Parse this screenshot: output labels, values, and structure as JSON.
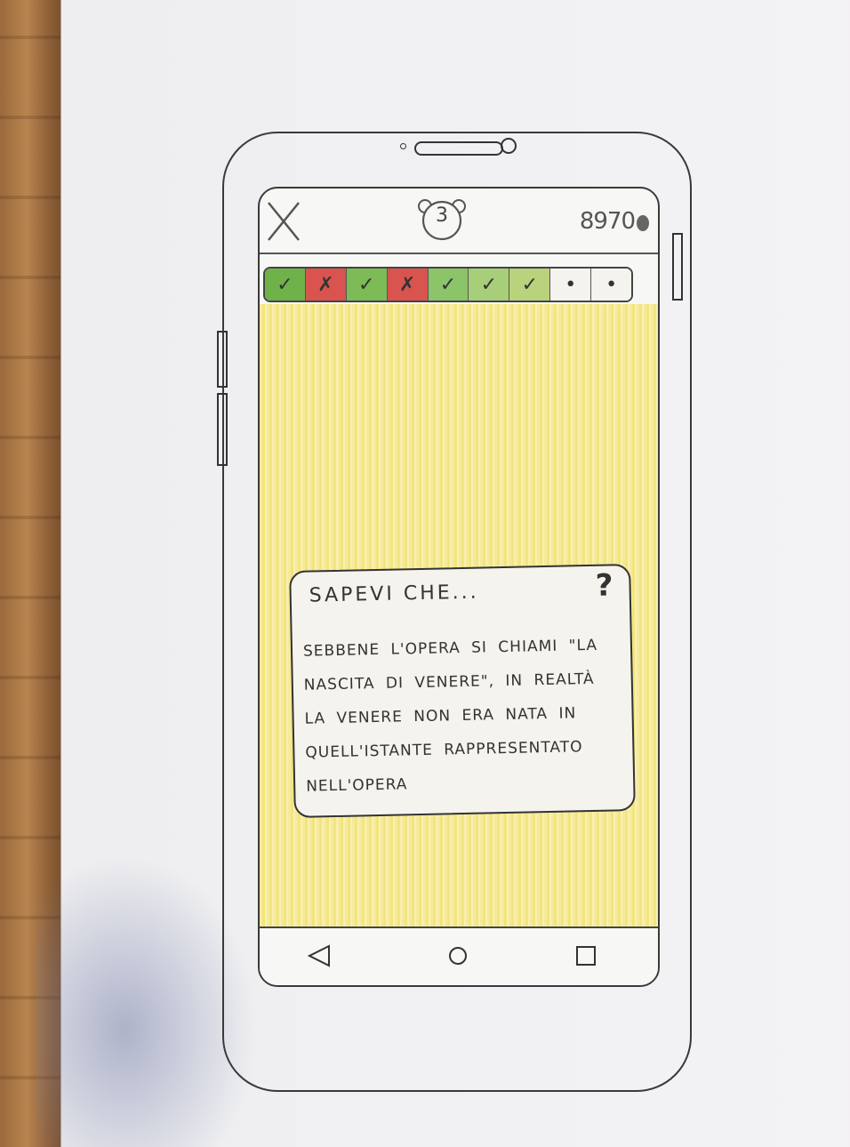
{
  "header": {
    "close_icon": "close-icon",
    "badge_icon": "bear-icon",
    "level": "3",
    "score": "8970"
  },
  "progress": {
    "segments": [
      {
        "state": "correct",
        "mark": "✓",
        "color": "#6fb24a"
      },
      {
        "state": "wrong",
        "mark": "✗",
        "color": "#d9534f"
      },
      {
        "state": "correct",
        "mark": "✓",
        "color": "#7dbb56"
      },
      {
        "state": "wrong",
        "mark": "✗",
        "color": "#d9534f"
      },
      {
        "state": "correct",
        "mark": "✓",
        "color": "#8cc46a"
      },
      {
        "state": "correct",
        "mark": "✓",
        "color": "#a7cf7a"
      },
      {
        "state": "correct",
        "mark": "✓",
        "color": "#b9d27c"
      },
      {
        "state": "pending",
        "mark": "•",
        "color": "#f4f3ee"
      },
      {
        "state": "pending",
        "mark": "•",
        "color": "#f4f3ee"
      }
    ]
  },
  "card": {
    "title": "SAPEVI CHE...",
    "icon": "question-icon",
    "body": "SEBBENE L'OPERA SI CHIAMI \"LA NASCITA DI VENERE\", IN REALTÀ LA VENERE NON ERA NATA IN QUELL'ISTANTE RAPPRESENTATO NELL'OPERA"
  },
  "navbar": {
    "back_icon": "back-triangle-icon",
    "home_icon": "home-circle-icon",
    "recents_icon": "recents-square-icon"
  },
  "colors": {
    "background_yellow": "#f4e882",
    "correct": "#6fb24a",
    "wrong": "#d9534f"
  }
}
